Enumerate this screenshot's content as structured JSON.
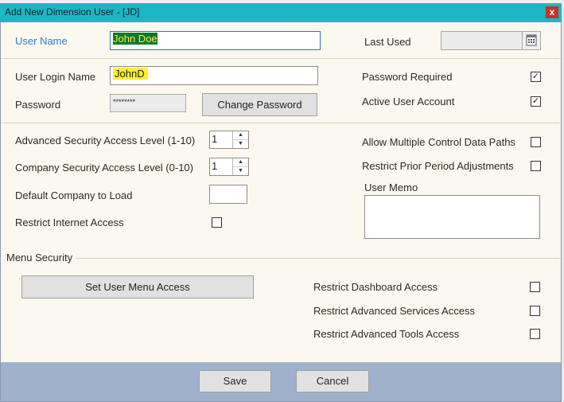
{
  "window": {
    "title": "Add New Dimension User - [JD]",
    "close_glyph": "x"
  },
  "identity": {
    "user_name_label": "User Name",
    "user_name_value": "John Doe",
    "last_used_label": "Last Used",
    "last_used_value": ""
  },
  "login": {
    "login_name_label": "User Login Name",
    "login_name_value": "JohnD",
    "password_label": "Password",
    "password_value": "********",
    "change_password_label": "Change Password",
    "password_required_label": "Password Required",
    "password_required_checked": true,
    "active_user_label": "Active User Account",
    "active_user_checked": true
  },
  "security": {
    "advanced_level_label": "Advanced Security Access Level (1-10)",
    "advanced_level_value": "1",
    "company_level_label": "Company Security Access Level (0-10)",
    "company_level_value": "1",
    "default_company_label": "Default Company to Load",
    "default_company_value": "",
    "restrict_internet_label": "Restrict Internet Access",
    "allow_multiple_paths_label": "Allow Multiple Control Data Paths",
    "restrict_prior_label": "Restrict Prior Period Adjustments",
    "user_memo_label": "User Memo",
    "user_memo_value": ""
  },
  "menu_security": {
    "section_label": "Menu Security",
    "set_menu_access_label": "Set User Menu Access",
    "restrict_dashboard_label": "Restrict Dashboard  Access",
    "restrict_adv_services_label": "Restrict Advanced Services  Access",
    "restrict_adv_tools_label": "Restrict Advanced Tools Access"
  },
  "footer": {
    "save_label": "Save",
    "cancel_label": "Cancel"
  },
  "checks": {
    "checked_glyph": "✓"
  },
  "spinner": {
    "up_glyph": "▲",
    "down_glyph": "▼"
  }
}
